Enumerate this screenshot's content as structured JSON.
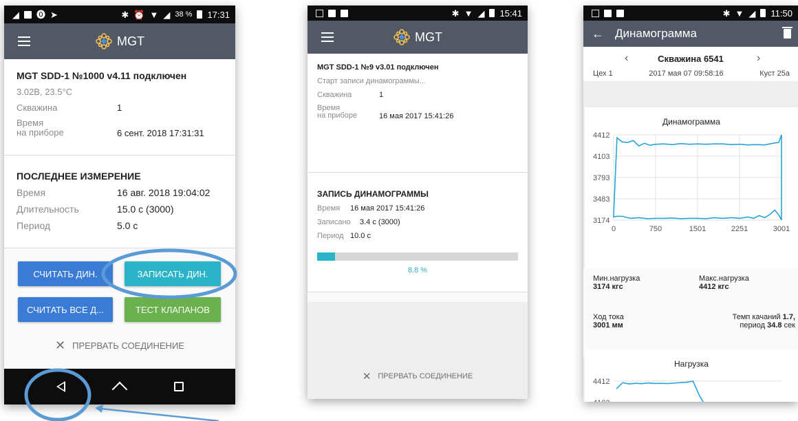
{
  "phone1": {
    "status": {
      "left_icons": [
        "signal-icon",
        "image-icon",
        "shield-icon",
        "navigation-icon"
      ],
      "battery": "38 %",
      "time": "17:31"
    },
    "toolbar": {
      "brand": "MGT"
    },
    "device": {
      "title": "MGT SDD-1 №1000 v4.11 подключен",
      "voltage": "3.02В, 23.5°С",
      "well_label": "Скважина",
      "well_value": "1",
      "time_label_1": "Время",
      "time_label_2": "на приборе",
      "time_value": "6 сент. 2018  17:31:31"
    },
    "last": {
      "title": "ПОСЛЕДНЕЕ ИЗМЕРЕНИЕ",
      "rows": [
        {
          "label": "Время",
          "value": "16 авг. 2018  19:04:02"
        },
        {
          "label": "Длительность",
          "value": "15.0 с (3000)"
        },
        {
          "label": "Период",
          "value": "5.0 с"
        }
      ]
    },
    "buttons": {
      "read": "СЧИТАТЬ ДИН.",
      "write": "ЗАПИСАТЬ ДИН.",
      "read_all": "СЧИТАТЬ ВСЕ Д...",
      "valve_test": "ТЕСТ КЛАПАНОВ"
    },
    "disconnect": "ПРЕРВАТЬ СОЕДИНЕНИЕ"
  },
  "phone2": {
    "status": {
      "time": "15:41"
    },
    "toolbar": {
      "brand": "MGT"
    },
    "device": {
      "title": "MGT SDD-1 №9 v3.01 подключен",
      "status_text": "Старт записи динамограммы...",
      "well_label": "Скважина",
      "well_value": "1",
      "time_label_1": "Время",
      "time_label_2": "на приборе",
      "time_value": "16 мая 2017  15:41:26"
    },
    "record": {
      "title": "ЗАПИСЬ ДИНАМОГРАММЫ",
      "time_label": "Время",
      "time_value": "16 мая 2017  15:41:26",
      "saved_label": "Записано",
      "saved_value": "3.4 с (3000)",
      "period_label": "Период",
      "period_value": "10.0 с",
      "progress": 0.088,
      "progress_text": "8.8 %"
    },
    "disconnect": "ПРЕРВАТЬ СОЕДИНЕНИЕ"
  },
  "phone3": {
    "status": {
      "time": "11:50"
    },
    "appbar": {
      "title": "Динамограмма"
    },
    "well": {
      "title": "Скважина 6541",
      "shop": "Цех 1",
      "datetime": "2017 мая 07 09:58:16",
      "cluster": "Куст 25а"
    },
    "chart_data": {
      "type": "line",
      "title": "Динамограмма",
      "xlabel": "",
      "ylabel": "",
      "x_ticks": [
        "0",
        "750",
        "1501",
        "2251",
        "3001"
      ],
      "y_ticks": [
        "4412",
        "4103",
        "3793",
        "3483",
        "3174"
      ],
      "xlim": [
        0,
        3001
      ],
      "ylim": [
        3174,
        4412
      ],
      "color": "#29a3d8",
      "series": [
        {
          "x": [
            0,
            60,
            150,
            250,
            350,
            450,
            550,
            650,
            750,
            900,
            1050,
            1200,
            1350,
            1501,
            1650,
            1800,
            1950,
            2100,
            2251,
            2400,
            2550,
            2700,
            2850,
            2950,
            3001,
            3001,
            2960,
            2880,
            2800,
            2700,
            2600,
            2500,
            2400,
            2251,
            2100,
            1950,
            1800,
            1650,
            1501,
            1350,
            1200,
            1050,
            900,
            750,
            600,
            450,
            300,
            150,
            60,
            0,
            0
          ],
          "y": [
            3260,
            4370,
            4310,
            4300,
            4330,
            4250,
            4290,
            4260,
            4275,
            4280,
            4270,
            4285,
            4275,
            4280,
            4275,
            4280,
            4280,
            4270,
            4275,
            4265,
            4270,
            4265,
            4290,
            4300,
            4412,
            3174,
            3240,
            3320,
            3260,
            3210,
            3240,
            3200,
            3220,
            3200,
            3210,
            3200,
            3210,
            3195,
            3200,
            3200,
            3195,
            3205,
            3200,
            3200,
            3195,
            3210,
            3200,
            3230,
            3230,
            3220,
            3260
          ]
        }
      ]
    },
    "stats": {
      "min_label": "Мин.нагрузка",
      "min_value": "3174 кгс",
      "max_label": "Макс.нагрузка",
      "max_value": "4412 кгс",
      "stroke_label": "Ход тока",
      "stroke_value": "3001 мм",
      "rate_label": "Темп качаний",
      "rate_value": "1.7,",
      "period_label": "период",
      "period_value": "34.8",
      "period_unit": "сек"
    },
    "chart2": {
      "title": "Нагрузка",
      "y_ticks": [
        "4412",
        "4103"
      ],
      "y": [
        4300,
        4390,
        4370,
        4380,
        4375,
        4385,
        4378,
        4380,
        4376,
        4382,
        4390,
        4395,
        4412,
        4200,
        4050
      ]
    }
  }
}
